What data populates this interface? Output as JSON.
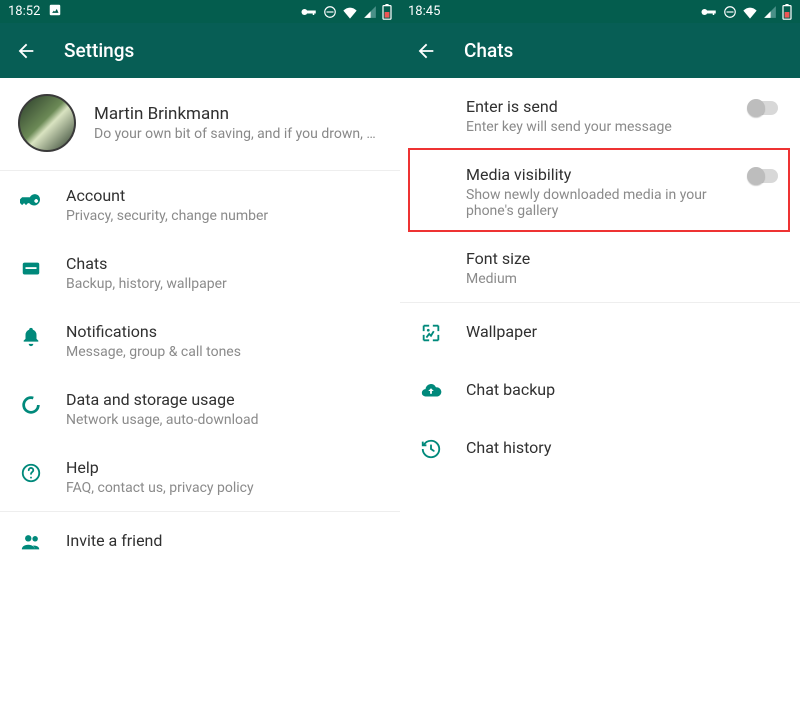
{
  "left": {
    "status": {
      "time": "18:52"
    },
    "title": "Settings",
    "profile": {
      "name": "Martin Brinkmann",
      "status_text": "Do your own bit of saving, and if you drown, at le…"
    },
    "items": {
      "account": {
        "label": "Account",
        "sub": "Privacy, security, change number"
      },
      "chats": {
        "label": "Chats",
        "sub": "Backup, history, wallpaper"
      },
      "notifs": {
        "label": "Notifications",
        "sub": "Message, group & call tones"
      },
      "data": {
        "label": "Data and storage usage",
        "sub": "Network usage, auto-download"
      },
      "help": {
        "label": "Help",
        "sub": "FAQ, contact us, privacy policy"
      },
      "invite": {
        "label": "Invite a friend"
      }
    }
  },
  "right": {
    "status": {
      "time": "18:45"
    },
    "title": "Chats",
    "items": {
      "enter_send": {
        "label": "Enter is send",
        "sub": "Enter key will send your message"
      },
      "media_vis": {
        "label": "Media visibility",
        "sub": "Show newly downloaded media in your phone's gallery"
      },
      "font_size": {
        "label": "Font size",
        "sub": "Medium"
      },
      "wallpaper": {
        "label": "Wallpaper"
      },
      "backup": {
        "label": "Chat backup"
      },
      "history": {
        "label": "Chat history"
      }
    }
  },
  "colors": {
    "accent": "#00897b",
    "appbar": "#075e55",
    "statusbar": "#045d4e",
    "highlight": "#e33"
  }
}
